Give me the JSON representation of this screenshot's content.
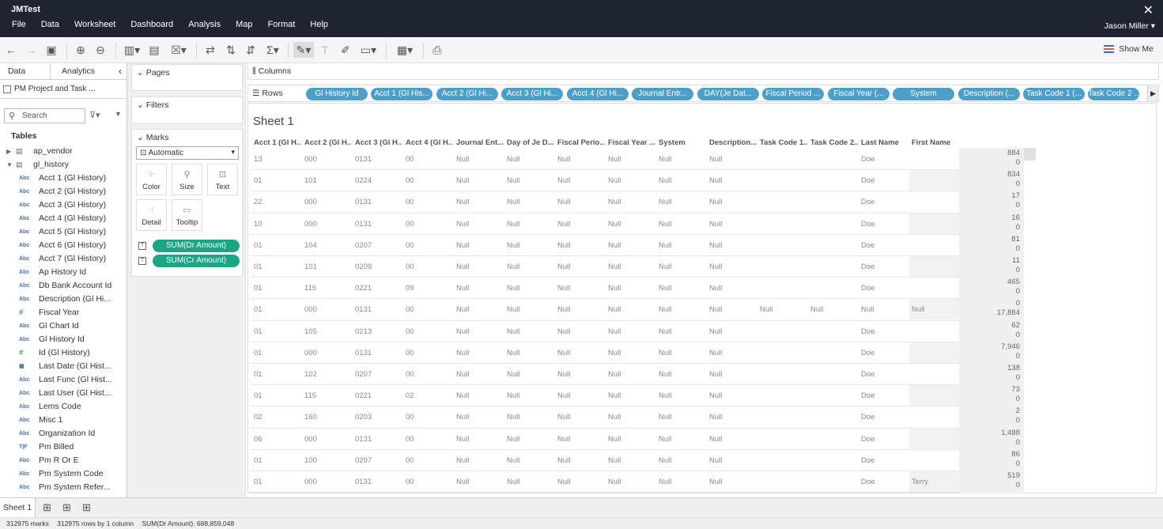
{
  "window": {
    "title": "JMTest",
    "close_glyph": "✕",
    "user": "Jason Miller"
  },
  "menu": [
    "File",
    "Data",
    "Worksheet",
    "Dashboard",
    "Analysis",
    "Map",
    "Format",
    "Help"
  ],
  "toolbar": {
    "show_me": "Show Me"
  },
  "left_panel": {
    "tab_data": "Data",
    "tab_analytics": "Analytics",
    "data_source": "PM Project and Task ...",
    "search_placeholder": "Search",
    "tables_heading": "Tables",
    "tables": [
      {
        "label": "ap_vendor",
        "expanded": false
      },
      {
        "label": "gl_history",
        "expanded": true
      }
    ],
    "fields": [
      {
        "type": "Abc",
        "label": "Acct 1 (Gl History)"
      },
      {
        "type": "Abc",
        "label": "Acct 2 (Gl History)"
      },
      {
        "type": "Abc",
        "label": "Acct 3 (Gl History)"
      },
      {
        "type": "Abc",
        "label": "Acct 4 (Gl History)"
      },
      {
        "type": "Abc",
        "label": "Acct 5 (Gl History)"
      },
      {
        "type": "Abc",
        "label": "Acct 6 (Gl History)"
      },
      {
        "type": "Abc",
        "label": "Acct 7 (Gl History)"
      },
      {
        "type": "Abc",
        "label": "Ap History Id"
      },
      {
        "type": "Abc",
        "label": "Db Bank Account Id"
      },
      {
        "type": "Abc",
        "label": "Description (Gl Hi..."
      },
      {
        "type": "#",
        "label": "Fiscal Year"
      },
      {
        "type": "Abc",
        "label": "Gl Chart Id"
      },
      {
        "type": "Abc",
        "label": "Gl History Id"
      },
      {
        "type": "#",
        "label": "Id (Gl History)"
      },
      {
        "type": "date",
        "label": "Last Date (Gl Hist..."
      },
      {
        "type": "Abc",
        "label": "Last Func (Gl Hist..."
      },
      {
        "type": "Abc",
        "label": "Last User (Gl Hist..."
      },
      {
        "type": "Abc",
        "label": "Lems Code"
      },
      {
        "type": "Abc",
        "label": "Misc 1"
      },
      {
        "type": "Abc",
        "label": "Organization Id"
      },
      {
        "type": "T|F",
        "label": "Pm Billed"
      },
      {
        "type": "Abc",
        "label": "Pm R Or E"
      },
      {
        "type": "Abc",
        "label": "Pm System Code"
      },
      {
        "type": "Abc",
        "label": "Pm System Refer..."
      }
    ]
  },
  "cards": {
    "pages": "Pages",
    "filters": "Filters",
    "marks": "Marks",
    "mark_type": "Automatic",
    "buttons": [
      "Color",
      "Size",
      "Text",
      "Detail",
      "Tooltip"
    ],
    "measures": [
      "SUM(Dr Amount)",
      "SUM(Cr Amount)"
    ]
  },
  "shelves": {
    "columns_label": "Columns",
    "rows_label": "Rows",
    "row_pills": [
      "Gl History Id",
      "Acct 1 (Gl His...",
      "Acct 2 (Gl Hi...",
      "Acct 3 (Gl Hi...",
      "Acct 4 (Gl Hi...",
      "Journal Entr...",
      "DAY(Je Dat...",
      "Fiscal Period ...",
      "Fiscal Year (...",
      "System",
      "Description (...",
      "Task Code 1 (...",
      "Task Code 2 ..."
    ]
  },
  "sheet": {
    "title": "Sheet 1",
    "headers": [
      "Acct 1 (Gl H...",
      "Acct 2 (Gl H...",
      "Acct 3 (Gl H...",
      "Acct 4 (Gl H...",
      "Journal Ent...",
      "Day of Je D...",
      "Fiscal Perio...",
      "Fiscal Year ...",
      "System",
      "Description...",
      "Task Code 1...",
      "Task Code 2...",
      "Last Name",
      "First Name"
    ],
    "rows": [
      {
        "cells": [
          "13",
          "000",
          "0131",
          "00",
          "Null",
          "Null",
          "Null",
          "Null",
          "Null",
          "Null",
          "",
          "",
          "Doe",
          ""
        ],
        "values": [
          "884",
          "0"
        ]
      },
      {
        "cells": [
          "01",
          "101",
          "0224",
          "00",
          "Null",
          "Null",
          "Null",
          "Null",
          "Null",
          "Null",
          "",
          "",
          "Doe",
          ""
        ],
        "values": [
          "834",
          "0"
        ]
      },
      {
        "cells": [
          "22",
          "000",
          "0131",
          "00",
          "Null",
          "Null",
          "Null",
          "Null",
          "Null",
          "Null",
          "",
          "",
          "Doe",
          ""
        ],
        "values": [
          "17",
          "0"
        ]
      },
      {
        "cells": [
          "10",
          "000",
          "0131",
          "00",
          "Null",
          "Null",
          "Null",
          "Null",
          "Null",
          "Null",
          "",
          "",
          "Doe",
          ""
        ],
        "values": [
          "16",
          "0"
        ]
      },
      {
        "cells": [
          "01",
          "104",
          "0207",
          "00",
          "Null",
          "Null",
          "Null",
          "Null",
          "Null",
          "Null",
          "",
          "",
          "Doe",
          ""
        ],
        "values": [
          "81",
          "0"
        ]
      },
      {
        "cells": [
          "01",
          "101",
          "0209",
          "00",
          "Null",
          "Null",
          "Null",
          "Null",
          "Null",
          "Null",
          "",
          "",
          "Doe",
          ""
        ],
        "values": [
          "11",
          "0"
        ]
      },
      {
        "cells": [
          "01",
          "115",
          "0221",
          "09",
          "Null",
          "Null",
          "Null",
          "Null",
          "Null",
          "Null",
          "",
          "",
          "Doe",
          ""
        ],
        "values": [
          "465",
          "0"
        ]
      },
      {
        "cells": [
          "01",
          "000",
          "0131",
          "00",
          "Null",
          "Null",
          "Null",
          "Null",
          "Null",
          "Null",
          "Null",
          "Null",
          "Null",
          "Null"
        ],
        "values": [
          "0",
          "17,884"
        ]
      },
      {
        "cells": [
          "01",
          "105",
          "0213",
          "00",
          "Null",
          "Null",
          "Null",
          "Null",
          "Null",
          "Null",
          "",
          "",
          "Doe",
          ""
        ],
        "values": [
          "62",
          "0"
        ]
      },
      {
        "cells": [
          "01",
          "000",
          "0131",
          "00",
          "Null",
          "Null",
          "Null",
          "Null",
          "Null",
          "Null",
          "",
          "",
          "Doe",
          ""
        ],
        "values": [
          "7,946",
          "0"
        ]
      },
      {
        "cells": [
          "01",
          "102",
          "0207",
          "00",
          "Null",
          "Null",
          "Null",
          "Null",
          "Null",
          "Null",
          "",
          "",
          "Doe",
          ""
        ],
        "values": [
          "138",
          "0"
        ]
      },
      {
        "cells": [
          "01",
          "115",
          "0221",
          "02",
          "Null",
          "Null",
          "Null",
          "Null",
          "Null",
          "Null",
          "",
          "",
          "Doe",
          ""
        ],
        "values": [
          "73",
          "0"
        ]
      },
      {
        "cells": [
          "02",
          "160",
          "0203",
          "00",
          "Null",
          "Null",
          "Null",
          "Null",
          "Null",
          "Null",
          "",
          "",
          "Doe",
          ""
        ],
        "values": [
          "2",
          "0"
        ]
      },
      {
        "cells": [
          "06",
          "000",
          "0131",
          "00",
          "Null",
          "Null",
          "Null",
          "Null",
          "Null",
          "Null",
          "",
          "",
          "Doe",
          ""
        ],
        "values": [
          "1,488",
          "0"
        ]
      },
      {
        "cells": [
          "01",
          "100",
          "0297",
          "00",
          "Null",
          "Null",
          "Null",
          "Null",
          "Null",
          "Null",
          "",
          "",
          "Doe",
          ""
        ],
        "values": [
          "86",
          "0"
        ]
      },
      {
        "cells": [
          "01",
          "000",
          "0131",
          "00",
          "Null",
          "Null",
          "Null",
          "Null",
          "Null",
          "Null",
          "",
          "",
          "Doe",
          "Terry"
        ],
        "values": [
          "519",
          "0"
        ]
      }
    ]
  },
  "bottom": {
    "sheet_tab": "Sheet 1"
  },
  "status": {
    "marks": "312975 marks",
    "rows": "312975 rows by 1 column",
    "sum": "SUM(Dr Amount): 688,859,048"
  },
  "colors": {
    "titlebar": "#1f2433",
    "measure_pill": "#1aa585",
    "dimension_pill": "#4e9fc8"
  }
}
